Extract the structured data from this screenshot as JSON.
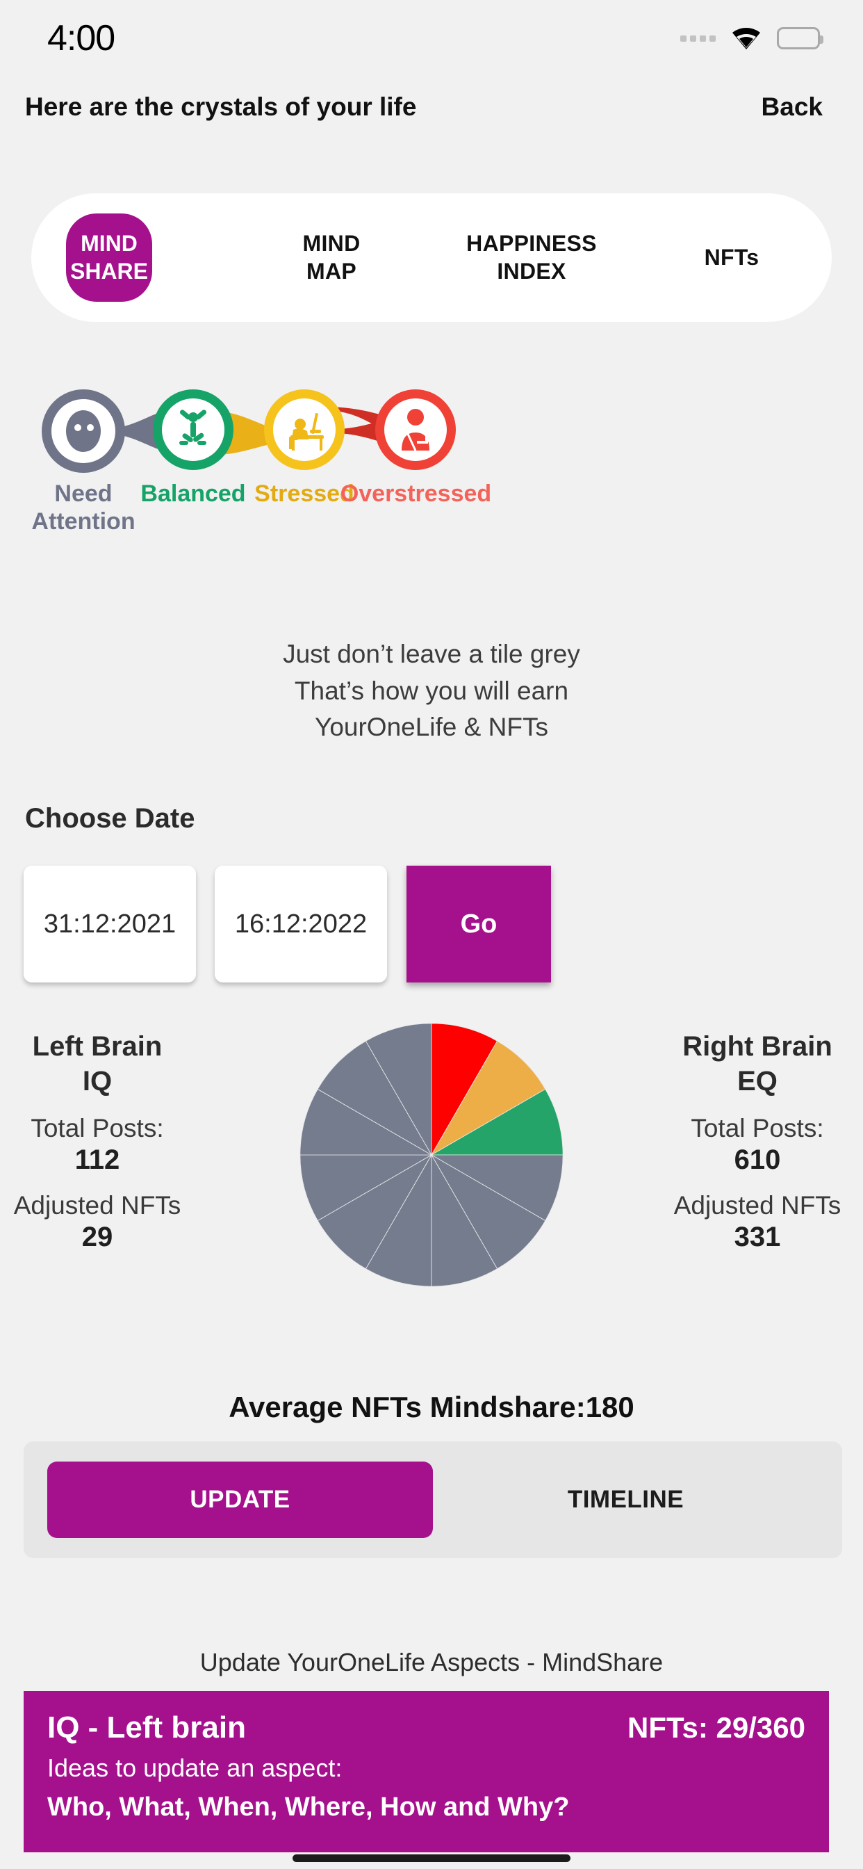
{
  "status_bar": {
    "time": "4:00",
    "signal_icon": "signal-dots-icon",
    "wifi_icon": "wifi-icon",
    "battery_icon": "battery-full-icon"
  },
  "header": {
    "title": "Here are the crystals of your life",
    "back_label": "Back"
  },
  "tabs": [
    {
      "label": "MIND SHARE",
      "line1": "MIND",
      "line2": "SHARE",
      "active": true
    },
    {
      "label": "MIND MAP",
      "line1": "MIND",
      "line2": "MAP",
      "active": false
    },
    {
      "label": "HAPPINESS INDEX",
      "line1": "HAPPINESS",
      "line2": "INDEX",
      "active": false
    },
    {
      "label": "NFTs",
      "line1": "NFTs",
      "line2": "",
      "active": false
    }
  ],
  "mood_scale": [
    {
      "label": "Need\nAttention",
      "label_line1": "Need",
      "label_line2": "Attention",
      "color": "#6f7489",
      "icon": "neutral-face-icon"
    },
    {
      "label": "Balanced",
      "label_line1": "Balanced",
      "label_line2": "",
      "color": "#16a368",
      "icon": "jumping-person-icon"
    },
    {
      "label": "Stressed",
      "label_line1": "Stressed",
      "label_line2": "",
      "color": "#f6c21c",
      "icon": "person-at-desk-icon"
    },
    {
      "label": "Overstressed",
      "label_line1": "Overstressed",
      "label_line2": "",
      "color": "#ef4136",
      "icon": "exhausted-person-icon"
    }
  ],
  "tagline": {
    "line1": "Just don’t leave a tile grey",
    "line2": "That’s how you will earn",
    "line3": "YourOneLife & NFTs"
  },
  "choose_date": {
    "heading": "Choose Date",
    "start_date": "31:12:2021",
    "end_date": "16:12:2022",
    "go_label": "Go"
  },
  "brain_stats": {
    "left": {
      "title_line1": "Left Brain",
      "title_line2": "IQ",
      "total_posts_label": "Total Posts:",
      "total_posts_value": "112",
      "adjusted_nfts_label": "Adjusted NFTs",
      "adjusted_nfts_value": "29"
    },
    "right": {
      "title_line1": "Right Brain",
      "title_line2": "EQ",
      "total_posts_label": "Total Posts:",
      "total_posts_value": "610",
      "adjusted_nfts_label": "Adjusted NFTs",
      "adjusted_nfts_value": "331"
    }
  },
  "average_line": "Average NFTs Mindshare:180",
  "segmented_control": {
    "update_label": "UPDATE",
    "timeline_label": "TIMELINE",
    "selected": "UPDATE"
  },
  "update_caption": "Update YourOneLife Aspects - MindShare",
  "aspect_card": {
    "title": "IQ - Left brain",
    "nfts": "NFTs: 29/360",
    "subtitle": "Ideas to update an aspect:",
    "question": "Who, What, When, Where, How and Why?",
    "bg_color": "#a5108c"
  },
  "colors": {
    "brand_magenta": "#a5108c",
    "page_bg": "#f1f1f1",
    "grey_slice": "#757c8e",
    "red_slice": "#fe0000",
    "amber_slice": "#eeae47",
    "green_slice": "#24a468"
  },
  "chart_data": {
    "type": "pie",
    "title": "",
    "categories": [
      "Overstressed",
      "Stressed",
      "Balanced",
      "Need Attention 1",
      "Need Attention 2",
      "Need Attention 3",
      "Need Attention 4",
      "Need Attention 5",
      "Need Attention 6",
      "Need Attention 7",
      "Need Attention 8",
      "Need Attention 9"
    ],
    "values": [
      1,
      1,
      1,
      1,
      1,
      1,
      1,
      1,
      1,
      1,
      1,
      1
    ],
    "slice_degrees": [
      30,
      30,
      30,
      30,
      30,
      30,
      30,
      30,
      30,
      30,
      30,
      30
    ],
    "colors": [
      "#fe0000",
      "#eeae47",
      "#24a468",
      "#757c8e",
      "#757c8e",
      "#757c8e",
      "#757c8e",
      "#757c8e",
      "#757c8e",
      "#757c8e",
      "#757c8e",
      "#757c8e"
    ],
    "start_angle_deg": 0,
    "direction": "clockwise",
    "legend": "none",
    "total_slices": 12,
    "filled_slices": 3,
    "grey_slices": 9
  }
}
